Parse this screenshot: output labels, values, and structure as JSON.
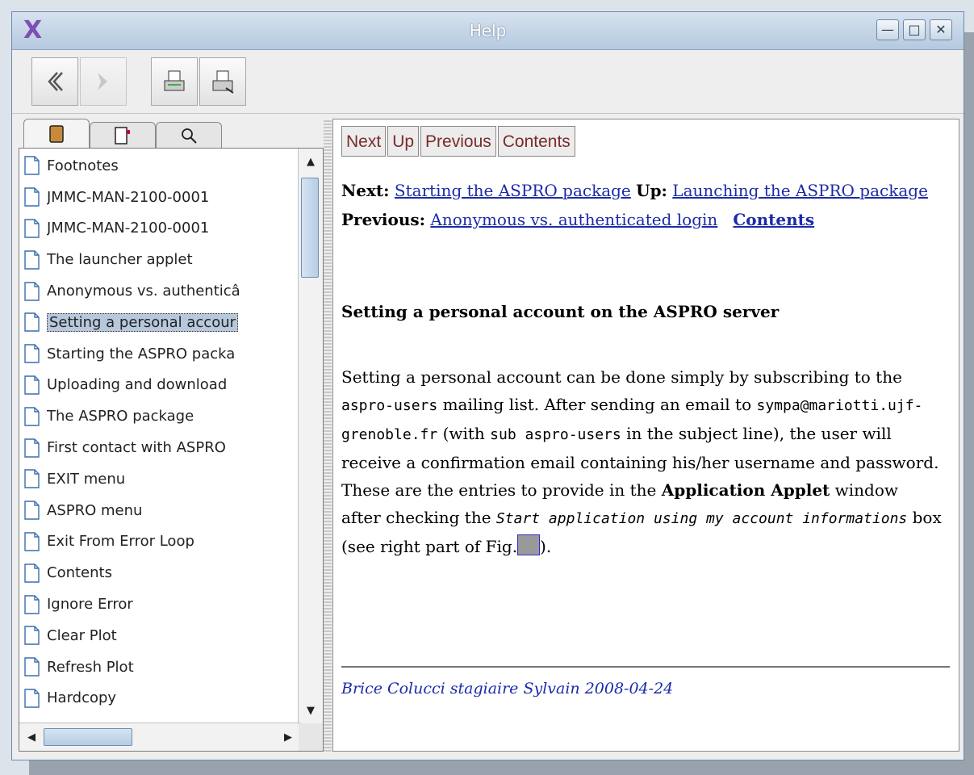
{
  "window": {
    "title": "Help",
    "app_icon": "X"
  },
  "titlebar_buttons": [
    "minimize-icon",
    "maximize-icon",
    "close-icon"
  ],
  "toolbar": [
    "back-icon",
    "forward-icon",
    "print-icon",
    "print-setup-icon"
  ],
  "sidebar": {
    "tabs": [
      "toc-book-icon",
      "index-icon",
      "search-icon"
    ],
    "items": [
      "Footnotes",
      "JMMC-MAN-2100-0001",
      "JMMC-MAN-2100-0001",
      "The launcher applet",
      "Anonymous vs. authenticâ",
      "Setting a personal accour",
      "Starting the ASPRO packa",
      "Uploading and download",
      "The ASPRO package",
      "First contact with ASPRO",
      "EXIT menu",
      "ASPRO menu",
      "Exit From Error Loop",
      "Contents",
      "Ignore Error",
      "Clear Plot",
      "Refresh Plot",
      "Hardcopy"
    ],
    "selected_index": 5
  },
  "content": {
    "nav_buttons": {
      "next": "Next",
      "up": "Up",
      "previous": "Previous",
      "contents": "Contents"
    },
    "nav": {
      "next_label": "Next:",
      "next_link": "Starting the ASPRO package",
      "up_label": "Up:",
      "up_link": "Launching the ASPRO package",
      "previous_label": "Previous:",
      "previous_link": "Anonymous vs. authenticated login",
      "contents_link": "Contents"
    },
    "heading": "Setting a personal account on the ASPRO server",
    "para": {
      "t1": "Setting a personal account can be done simply by subscribing to the ",
      "code1": "aspro-users",
      "t2": " mailing list. After sending an email to ",
      "code2": "sympa@mariotti.ujf-grenoble.fr",
      "t3": " (with ",
      "code3": "sub aspro-users",
      "t4": " in the subject line), the user will receive a confirmation email containing his/her username and password. These are the entries to provide in the ",
      "bold1": "Application Applet",
      "t5": " window after checking the ",
      "italic1": "Start application using my account informations",
      "t6": " box (see right part of Fig.",
      "t7": ")."
    },
    "footer": "Brice Colucci stagiaire Sylvain 2008-04-24"
  }
}
